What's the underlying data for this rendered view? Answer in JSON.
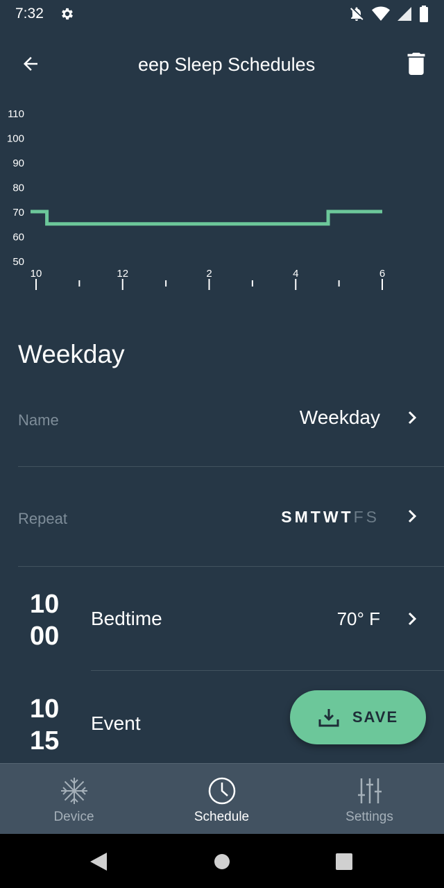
{
  "status_bar": {
    "time": "7:32"
  },
  "app_bar": {
    "title": "eep Sleep Schedules"
  },
  "chart_data": {
    "type": "line",
    "y_ticks": [
      "110",
      "100",
      "90",
      "80",
      "70",
      "60",
      "50"
    ],
    "x_ticks": [
      "10",
      "12",
      "2",
      "4",
      "6"
    ],
    "ylim": [
      50,
      110
    ],
    "series": [
      {
        "x": [
          "10:00",
          "10:15",
          "4:45",
          "6:00"
        ],
        "y": [
          70,
          65,
          70,
          70
        ]
      }
    ],
    "line_color": "#6cc79a"
  },
  "schedule": {
    "title": "Weekday",
    "name_label": "Name",
    "name_value": "Weekday",
    "repeat_label": "Repeat",
    "days": [
      {
        "letter": "S",
        "active": true
      },
      {
        "letter": "M",
        "active": true
      },
      {
        "letter": "T",
        "active": true
      },
      {
        "letter": "W",
        "active": true
      },
      {
        "letter": "T",
        "active": true
      },
      {
        "letter": "F",
        "active": false
      },
      {
        "letter": "S",
        "active": false
      }
    ],
    "events": [
      {
        "hour": "10",
        "minute": "00",
        "name": "Bedtime",
        "temp": "70° F"
      },
      {
        "hour": "10",
        "minute": "15",
        "name": "Event",
        "temp": ""
      }
    ]
  },
  "fab": {
    "label": "SAVE",
    "color": "#6cc79a"
  },
  "bottom_nav": {
    "items": [
      {
        "label": "Device",
        "icon": "snowflake-icon",
        "active": false
      },
      {
        "label": "Schedule",
        "icon": "clock-icon",
        "active": true
      },
      {
        "label": "Settings",
        "icon": "sliders-icon",
        "active": false
      }
    ]
  }
}
